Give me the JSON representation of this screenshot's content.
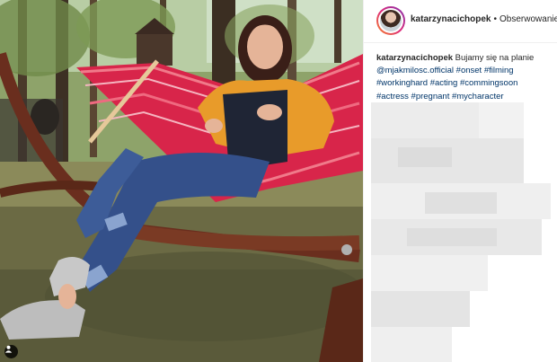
{
  "post": {
    "username": "katarzynacichopek",
    "separator": "•",
    "follow_label": "Obserwowanie"
  },
  "caption": {
    "username": "katarzynacichopek",
    "text": "Bujamy się na planie",
    "mention": "@mjakmilosc.official",
    "hashtags": [
      "#onset",
      "#filming",
      "#workinghard",
      "#acting",
      "#commingsoon",
      "#actress",
      "#pregnant",
      "#mycharacter"
    ]
  },
  "icons": {
    "tagged_user": "person-icon",
    "avatar": "avatar-icon"
  },
  "colors": {
    "link": "#003569",
    "text": "#262626",
    "border": "#efefef",
    "hammock_red": "#d8254a",
    "jacket_orange": "#e89b2a"
  }
}
